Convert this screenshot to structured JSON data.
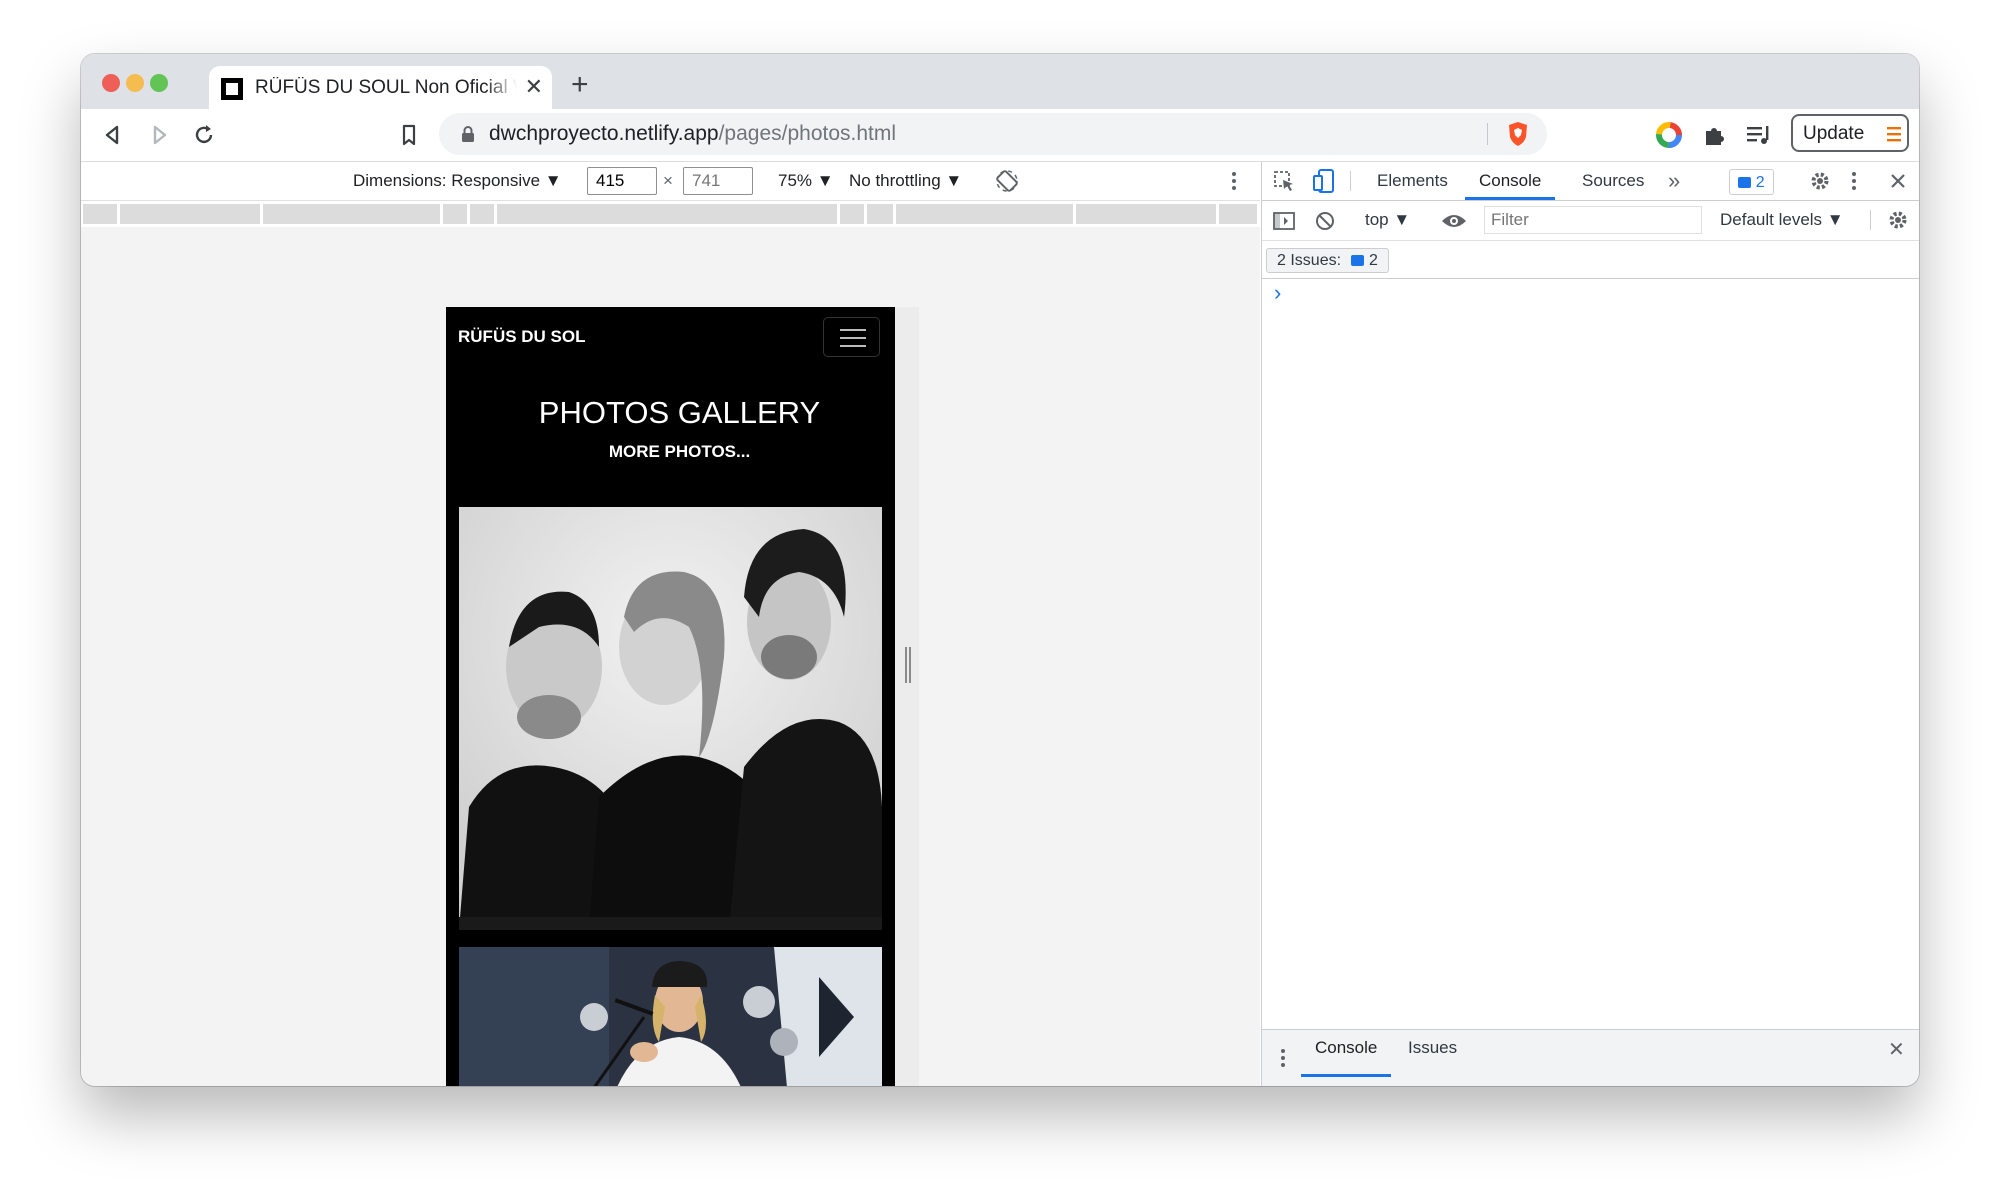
{
  "browser": {
    "tab_title": "RÜFÜS DU SOUL Non Oficial Web",
    "tab_close": "✕",
    "new_tab": "+",
    "url_host": "dwchproyecto.netlify.app",
    "url_path": "/pages/photos.html",
    "update_label": "Update"
  },
  "device_toolbar": {
    "dimensions_label": "Dimensions: Responsive ▼",
    "width_value": "415",
    "times": "×",
    "height_placeholder": "741",
    "zoom_label": "75% ▼",
    "throttling_label": "No throttling ▼"
  },
  "site": {
    "brand": "RÜFÜS DU SOL",
    "gallery_title": "PHOTOS GALLERY",
    "more_link": "MORE PHOTOS..."
  },
  "devtools": {
    "tabs": [
      "Elements",
      "Console",
      "Sources"
    ],
    "more_tabs": "»",
    "issues_badge_count": "2",
    "context": "top ▼",
    "filter_placeholder": "Filter",
    "levels": "Default levels ▼",
    "issues_label": "2 Issues:",
    "issues_count": "2",
    "prompt": "›",
    "drawer_tabs": [
      "Console",
      "Issues"
    ],
    "drawer_close": "✕"
  },
  "colors": {
    "accent": "#1a73e8",
    "site_background": "#000000",
    "brave_orange": "#fb542b",
    "update_orange": "#e8710a"
  }
}
